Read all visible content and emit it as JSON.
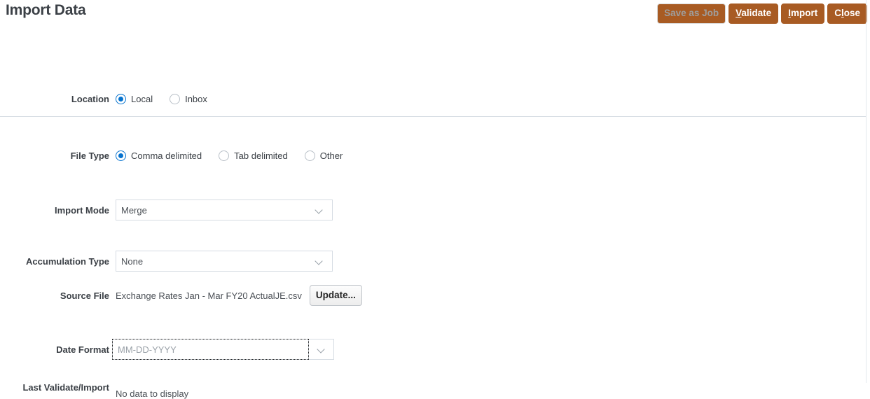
{
  "header": {
    "title": "Import Data",
    "actions": [
      {
        "label": "Save as Job",
        "accel": "",
        "disabled": true
      },
      {
        "label": "Validate",
        "accel": "V",
        "disabled": false
      },
      {
        "label": "Import",
        "accel": "I",
        "disabled": false
      },
      {
        "label": "Close",
        "accel": "l",
        "disabled": false
      }
    ]
  },
  "form": {
    "location": {
      "label": "Location",
      "options": [
        {
          "label": "Local",
          "selected": true
        },
        {
          "label": "Inbox",
          "selected": false
        }
      ]
    },
    "file_type": {
      "label": "File Type",
      "options": [
        {
          "label": "Comma delimited",
          "selected": true
        },
        {
          "label": "Tab delimited",
          "selected": false
        },
        {
          "label": "Other",
          "selected": false
        }
      ]
    },
    "import_mode": {
      "label": "Import Mode",
      "value": "Merge"
    },
    "accumulation_type": {
      "label": "Accumulation Type",
      "value": "None"
    },
    "source_file": {
      "label": "Source File",
      "value": "Exchange Rates Jan - Mar FY20 ActualJE.csv",
      "update_button": "Update..."
    },
    "date_format": {
      "label": "Date Format",
      "value": "MM-DD-YYYY"
    },
    "last_validate_import": {
      "label": "Last Validate/Import",
      "value": "No data to display"
    }
  },
  "colors": {
    "action_button": "#a85b23",
    "radio_selected": "#0572ce",
    "label_text": "#3b4046",
    "divider": "#d6dce3"
  },
  "icons": {
    "chevron_down": "chevron-down-icon"
  }
}
